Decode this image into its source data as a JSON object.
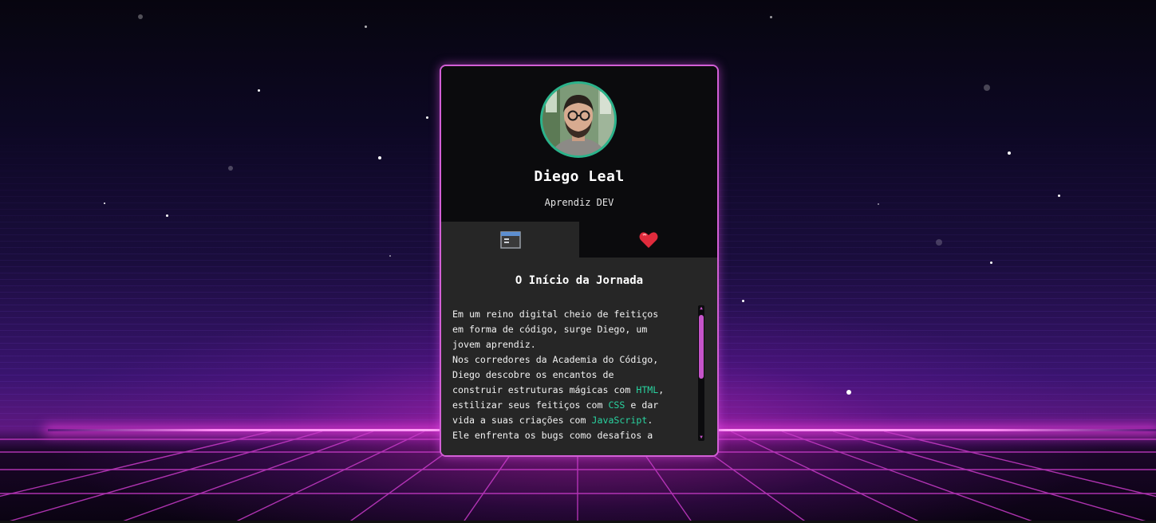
{
  "profile": {
    "name": "Diego Leal",
    "role": "Aprendiz DEV"
  },
  "tabs": [
    {
      "icon": "code-window-icon"
    },
    {
      "icon": "heart-icon"
    }
  ],
  "content": {
    "title": "O Início da Jornada",
    "lines": [
      "Em um reino digital cheio de feitiços",
      "em forma de código, surge Diego, um",
      "jovem aprendiz.",
      "Nos corredores da Academia do Código,",
      "Diego descobre os encantos de",
      "construir estruturas mágicas com ",
      "HTML",
      ",",
      "estilizar seus feitiços com ",
      "CSS",
      " e dar",
      "vida a suas criações com ",
      "JavaScript",
      ".",
      "Ele enfrenta os bugs como desafios a"
    ]
  },
  "colors": {
    "accent": "#d35fd6",
    "keyword": "#29d3a0",
    "avatar_ring": "#2bb38b",
    "card_bg": "#0b0b0d",
    "panel_bg": "#262626"
  }
}
